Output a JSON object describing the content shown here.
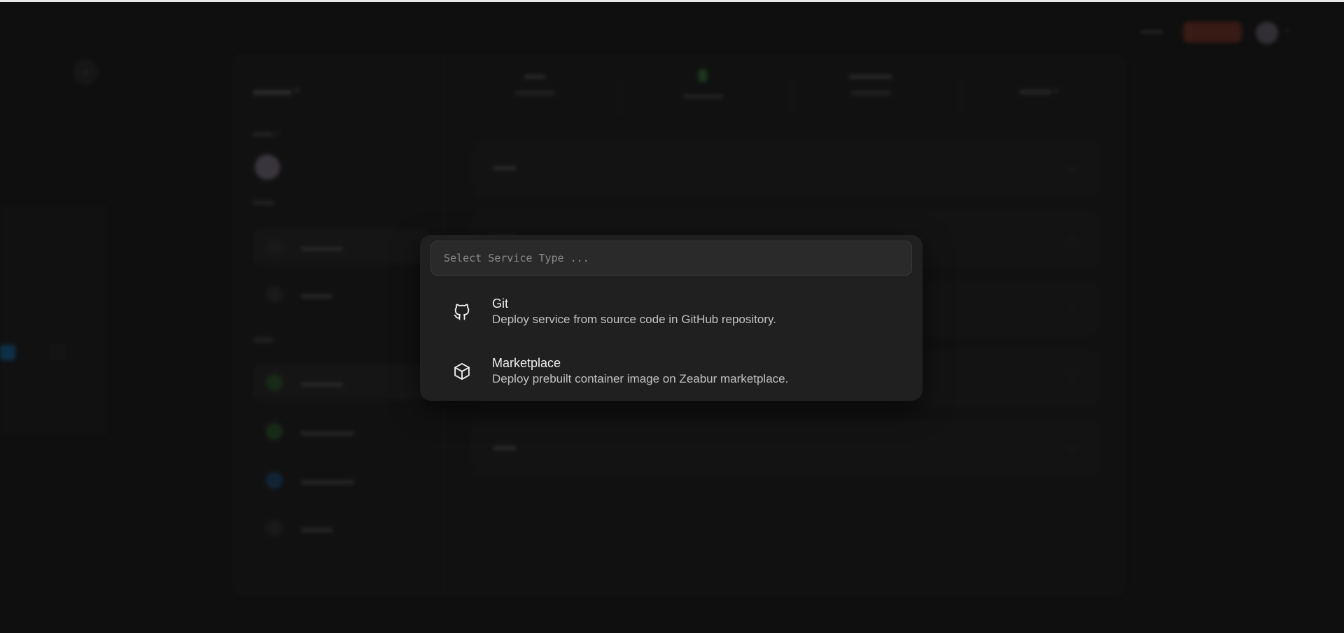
{
  "palette": {
    "search_placeholder": "Select Service Type ...",
    "options": [
      {
        "title": "Git",
        "description": "Deploy service from source code in GitHub repository.",
        "icon": "github-icon"
      },
      {
        "title": "Marketplace",
        "description": "Deploy prebuilt container image on Zeabur marketplace.",
        "icon": "package-icon"
      }
    ]
  },
  "colors": {
    "page_background": "#101010",
    "palette_background": "#202020",
    "search_background": "#2a2a2a",
    "overlay": "rgba(14,14,14,0.55)"
  }
}
